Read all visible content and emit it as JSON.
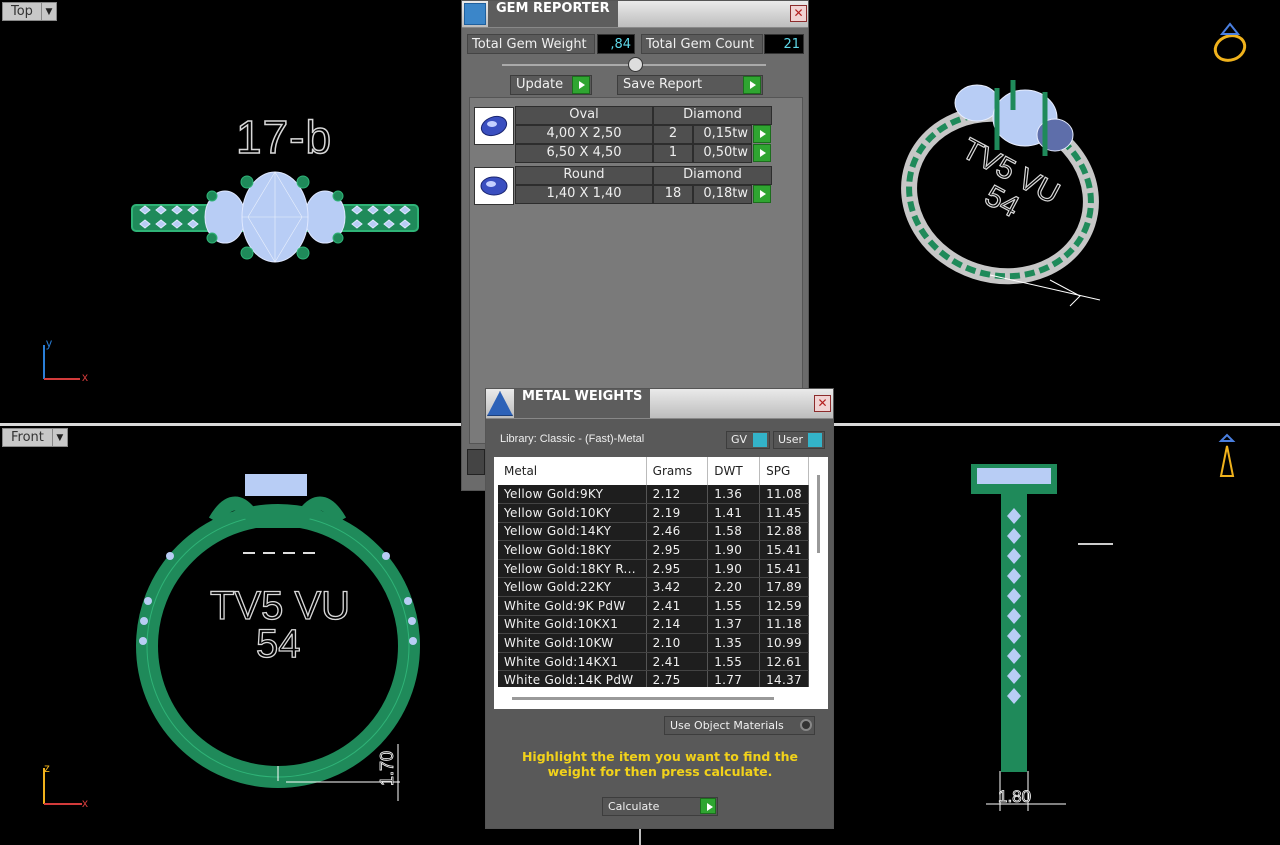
{
  "viewports": {
    "top": {
      "label": "Top",
      "engraving_label": "17-b"
    },
    "front": {
      "label": "Front",
      "engraving_line1": "TV5 VU",
      "engraving_line2": "54",
      "dimension": "1.70"
    },
    "perspective": {
      "engraving_line1": "TV5 VU",
      "engraving_line2": "54"
    },
    "right": {
      "dimension": "1.80"
    }
  },
  "axes": {
    "y": "y",
    "x": "x",
    "z": "z"
  },
  "gem_reporter": {
    "title": "GEM REPORTER",
    "total_weight_label": "Total Gem Weight",
    "total_weight_value": ",84",
    "total_count_label": "Total Gem Count",
    "total_count_value": "21",
    "update_label": "Update",
    "save_report_label": "Save Report",
    "groups": [
      {
        "shape": "Oval",
        "material": "Diamond",
        "rows": [
          {
            "size": "4,00 X 2,50",
            "count": "2",
            "weight": "0,15tw"
          },
          {
            "size": "6,50 X 4,50",
            "count": "1",
            "weight": "0,50tw"
          }
        ]
      },
      {
        "shape": "Round",
        "material": "Diamond",
        "rows": [
          {
            "size": "1,40 X 1,40",
            "count": "18",
            "weight": "0,18tw"
          }
        ]
      }
    ]
  },
  "metal_weights": {
    "title": "METAL WEIGHTS",
    "library": "Library: Classic - (Fast)-Metal",
    "gv_label": "GV",
    "user_label": "User",
    "columns": [
      "Metal",
      "Grams",
      "DWT",
      "SPG"
    ],
    "rows": [
      [
        "Yellow Gold:9KY",
        "2.12",
        "1.36",
        "11.08"
      ],
      [
        "Yellow Gold:10KY",
        "2.19",
        "1.41",
        "11.45"
      ],
      [
        "Yellow Gold:14KY",
        "2.46",
        "1.58",
        "12.88"
      ],
      [
        "Yellow Gold:18KY",
        "2.95",
        "1.90",
        "15.41"
      ],
      [
        "Yellow Gold:18KY R...",
        "2.95",
        "1.90",
        "15.41"
      ],
      [
        "Yellow Gold:22KY",
        "3.42",
        "2.20",
        "17.89"
      ],
      [
        "White Gold:9K PdW",
        "2.41",
        "1.55",
        "12.59"
      ],
      [
        "White Gold:10KX1",
        "2.14",
        "1.37",
        "11.18"
      ],
      [
        "White Gold:10KW",
        "2.10",
        "1.35",
        "10.99"
      ],
      [
        "White Gold:14KX1",
        "2.41",
        "1.55",
        "12.61"
      ],
      [
        "White Gold:14K PdW",
        "2.75",
        "1.77",
        "14.37"
      ]
    ],
    "use_object_materials": "Use Object Materials",
    "hint": "Highlight the item you want to find the weight for then press calculate.",
    "calculate_label": "Calculate"
  },
  "colors": {
    "metal_green": "#1f8a5a",
    "gem_blue": "#b8cdf5",
    "hint_yellow": "#f2d21a",
    "value_cyan": "#5fd7e8",
    "button_green": "#2fa531"
  }
}
